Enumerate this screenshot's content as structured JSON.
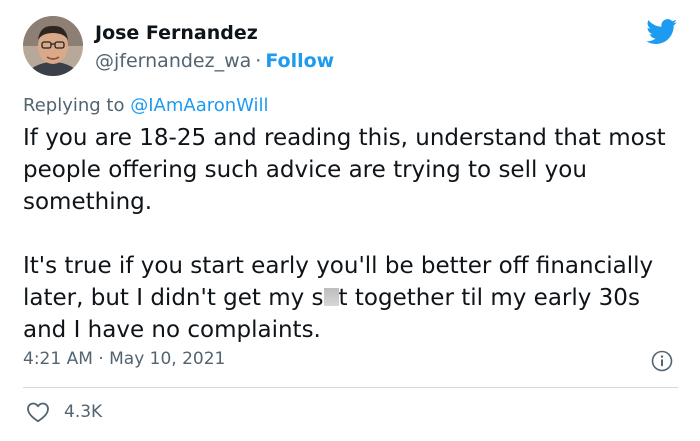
{
  "author": {
    "name": "Jose Fernandez",
    "handle": "@jfernandez_wa",
    "separator": "·",
    "follow_label": "Follow"
  },
  "reply": {
    "prefix": "Replying to",
    "mention": "@IAmAaronWill"
  },
  "tweet": {
    "paragraph_1": "If you are 18-25 and reading this, understand that most people offering such advice are trying to sell you something.",
    "paragraph_2_before": "It's true if you start early you'll be better off financially later, but I didn't get my s",
    "paragraph_2_after": "t together til my early 30s and I have no complaints."
  },
  "meta": {
    "time": "4:21 AM",
    "separator": "·",
    "date": "May 10, 2021"
  },
  "actions": {
    "like_count": "4.3K"
  },
  "icons": {
    "brand": "twitter-bird-icon",
    "info": "info-icon",
    "like": "heart-icon"
  },
  "colors": {
    "accent": "#1d9bf0",
    "text": "#0f1419",
    "secondary": "#536471",
    "divider": "#cfd9de"
  }
}
